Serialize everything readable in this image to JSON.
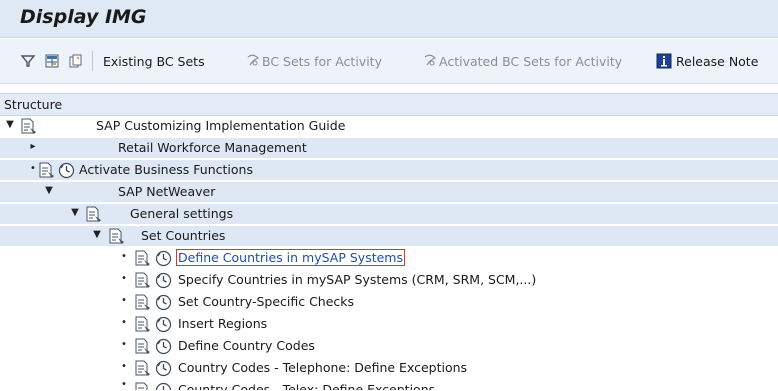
{
  "window": {
    "title": "Display IMG"
  },
  "toolbar": {
    "existing_bc_sets": "Existing BC Sets",
    "bc_sets_for_activity": "BC Sets for Activity",
    "activated_bc_sets": "Activated BC Sets for Activity",
    "release_notes": "Release Note"
  },
  "structure": {
    "header": "Structure"
  },
  "tree": {
    "rows": [
      {
        "label": "SAP Customizing Implementation Guide"
      },
      {
        "label": "Retail Workforce Management"
      },
      {
        "label": "Activate Business Functions"
      },
      {
        "label": "SAP NetWeaver"
      },
      {
        "label": "General settings"
      },
      {
        "label": "Set Countries"
      },
      {
        "label": "Define Countries in mySAP Systems"
      },
      {
        "label": "Specify Countries in mySAP Systems (CRM, SRM, SCM,...)"
      },
      {
        "label": "Set Country-Specific Checks"
      },
      {
        "label": "Insert Regions"
      },
      {
        "label": "Define Country Codes"
      },
      {
        "label": "Country Codes - Telephone: Define Exceptions"
      },
      {
        "label": "Country Codes - Telex: Define Exceptions"
      }
    ]
  },
  "colors": {
    "header_bg": "#dfe9f5",
    "toolbar_bg": "#eef3f9",
    "row_shade": "#dde8f4",
    "link": "#1e4fa8",
    "focus": "#e03030"
  }
}
